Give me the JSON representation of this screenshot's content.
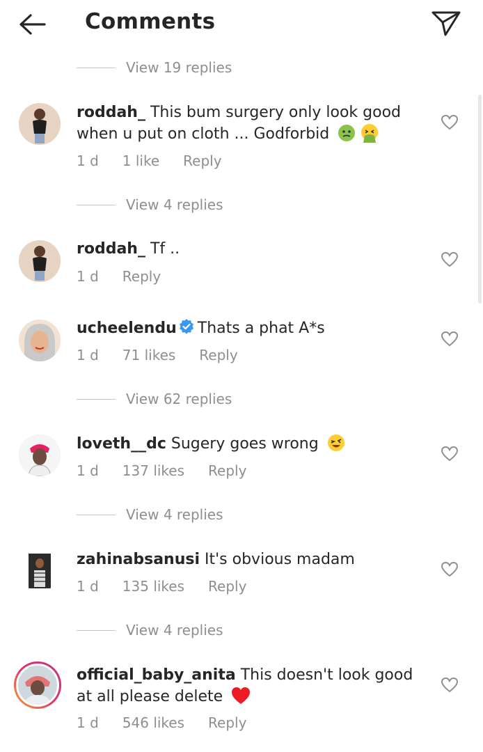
{
  "header": {
    "title": "Comments",
    "back_icon": "arrow-left-icon",
    "share_icon": "paper-plane-icon"
  },
  "colors": {
    "text": "#262626",
    "muted": "#8e8e8e",
    "verified": "#3897f0",
    "heart_red": "#ed1c24"
  },
  "view_replies": [
    {
      "label": "View 19 replies"
    },
    {
      "label": "View 4 replies"
    },
    {
      "label": "View 62 replies"
    },
    {
      "label": "View 4 replies"
    },
    {
      "label": "View 4 replies"
    }
  ],
  "comments": [
    {
      "username": "roddah_",
      "line1": "This bum surgery only look good",
      "line2": "when u put on cloth ... Godforbid",
      "time": "1 d",
      "likes": "1 like",
      "reply": "Reply",
      "emoji": [
        "sick-face-emoji",
        "vomiting-face-emoji"
      ]
    },
    {
      "username": "roddah_",
      "line1": "Tf ..",
      "time": "1 d",
      "reply": "Reply"
    },
    {
      "username": "ucheelendu",
      "verified": true,
      "line1": "Thats a phat A*s",
      "time": "1 d",
      "likes": "71 likes",
      "reply": "Reply"
    },
    {
      "username": "loveth__dc",
      "line1": "Sugery goes wrong",
      "time": "1 d",
      "likes": "137 likes",
      "reply": "Reply",
      "emoji": [
        "laughing-emoji"
      ]
    },
    {
      "username": "zahinabsanusi",
      "line1": "It's obvious madam",
      "time": "1 d",
      "likes": "135 likes",
      "reply": "Reply"
    },
    {
      "username": "official_baby_anita",
      "line1": "This doesn't look good",
      "line2": "at all please delete",
      "time": "1 d",
      "likes": "546 likes",
      "reply": "Reply",
      "emoji": [
        "red-heart-emoji"
      ]
    }
  ]
}
